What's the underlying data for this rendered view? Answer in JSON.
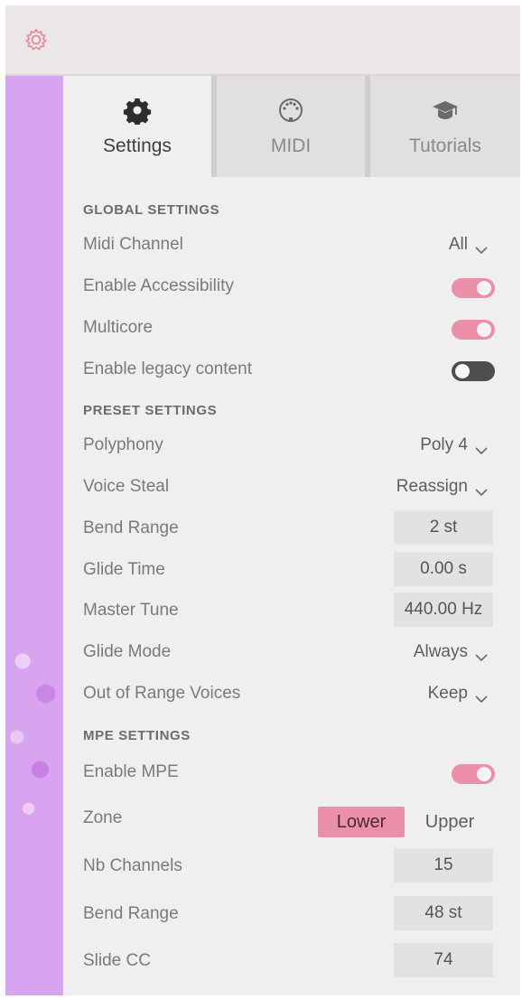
{
  "tabs": [
    {
      "label": "Settings",
      "icon": "gear-icon",
      "active": true
    },
    {
      "label": "MIDI",
      "icon": "midi-port-icon",
      "active": false
    },
    {
      "label": "Tutorials",
      "icon": "graduation-cap-icon",
      "active": false
    }
  ],
  "global": {
    "title": "GLOBAL SETTINGS",
    "midi_channel": {
      "label": "Midi Channel",
      "value": "All"
    },
    "accessibility": {
      "label": "Enable Accessibility",
      "on": true
    },
    "multicore": {
      "label": "Multicore",
      "on": true
    },
    "legacy": {
      "label": "Enable legacy content",
      "on": false
    }
  },
  "preset": {
    "title": "PRESET SETTINGS",
    "polyphony": {
      "label": "Polyphony",
      "value": "Poly 4"
    },
    "voice_steal": {
      "label": "Voice Steal",
      "value": "Reassign"
    },
    "bend_range": {
      "label": "Bend Range",
      "value": "2 st"
    },
    "glide_time": {
      "label": "Glide Time",
      "value": "0.00 s"
    },
    "master_tune": {
      "label": "Master Tune",
      "value": "440.00 Hz"
    },
    "glide_mode": {
      "label": "Glide Mode",
      "value": "Always"
    },
    "out_of_range": {
      "label": "Out of Range Voices",
      "value": "Keep"
    }
  },
  "mpe": {
    "title": "MPE SETTINGS",
    "enable": {
      "label": "Enable MPE",
      "on": true
    },
    "zone": {
      "label": "Zone",
      "options": [
        "Lower",
        "Upper"
      ],
      "selected": "Lower"
    },
    "nb_channels": {
      "label": "Nb Channels",
      "value": "15"
    },
    "bend_range": {
      "label": "Bend Range",
      "value": "48 st"
    },
    "slide_cc": {
      "label": "Slide CC",
      "value": "74"
    }
  },
  "colors": {
    "accent_pink": "#ec8fa8",
    "sidebar_purple": "#d9a4ef",
    "panel_bg": "#f0efef",
    "topbar_bg": "#eae7e6",
    "toggle_off": "#4e4e4e"
  }
}
